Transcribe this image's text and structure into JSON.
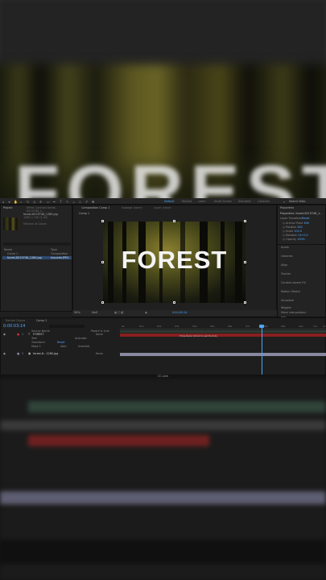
{
  "menu": {
    "workspaces": [
      "Default",
      "Review",
      "Learn",
      "Small Screen",
      "Standard",
      "Libraries"
    ],
    "active_workspace": "Default",
    "search_help": "Search Help"
  },
  "project_panel": {
    "tab": "Project",
    "file_name": "forest-8219746_1280.jpg",
    "file_info": "1280 x 720 (1.00)",
    "millions": "Millions of Colors",
    "col_name": "Name",
    "col_type": "Type",
    "items": [
      {
        "name": "Comp 1",
        "type": "Composition"
      },
      {
        "name": "forest-8219746_1280.jpg",
        "type": "ImporterJPEG"
      }
    ],
    "bpc": "8 bpc"
  },
  "effect_controls": {
    "tab": "Effect Controls forest-8219746_1..."
  },
  "composition": {
    "tab": "Composition Comp 1",
    "sub_tab": "Comp 1",
    "footage_tab": "Footage (none)",
    "layer_tab": "Layer (none)",
    "title_text": "FOREST",
    "zoom": "50%",
    "quality": "Half",
    "timecode": "0:00:03:14"
  },
  "properties": {
    "header": "Properties: forest-8219746_1...",
    "layer_transform": "Layer Transform",
    "reset": "Reset",
    "rows": [
      {
        "label": "Anchor Point",
        "value": "640"
      },
      {
        "label": "Position",
        "value": "640"
      },
      {
        "label": "Scale",
        "value": "100.0"
      },
      {
        "label": "Rotation",
        "value": "0x+0.0"
      },
      {
        "label": "Opacity",
        "value": "100%"
      }
    ],
    "sections": [
      "Audio",
      "Libraries",
      "Align",
      "Tracker",
      "Content-Aware Fill",
      "Motion Sketch",
      "Smoother",
      "Wiggler",
      "Mask Interpolation",
      "Info"
    ]
  },
  "timeline": {
    "render_queue": "Render Queue",
    "tab": "Comp 1",
    "timecode": "0:00:03:14",
    "col_source": "Source Name",
    "col_parent": "Parent & Link",
    "layers": [
      {
        "num": "1",
        "name": "FOREST",
        "parent": "None"
      },
      {
        "num": "2",
        "name": "forest-8...1280.jpg",
        "parent": "None"
      }
    ],
    "text_label": "Text",
    "animate": "Animate:",
    "transform": "Transform",
    "reset": "Reset",
    "add": "Add:",
    "inverted": "Inverted",
    "mask1": "Mask 1",
    "ruler": [
      "0s",
      "01s",
      "02s",
      "03s",
      "04s",
      "05s",
      "06s",
      "07s",
      "08s",
      "09s",
      "10s",
      "11s",
      "12s"
    ],
    "bar_label": "Time Ruler (Click to set thumb)",
    "footer_left": "Frame Render Time: 0ms",
    "footer_mid": "Toggle Switches / Modes"
  },
  "taskbar": {
    "label": "CC.com"
  },
  "colors": {
    "accent": "#4da6ff",
    "track_red": "#8a2020",
    "track_purple": "#8888a0",
    "track_green": "#3a5a40"
  }
}
